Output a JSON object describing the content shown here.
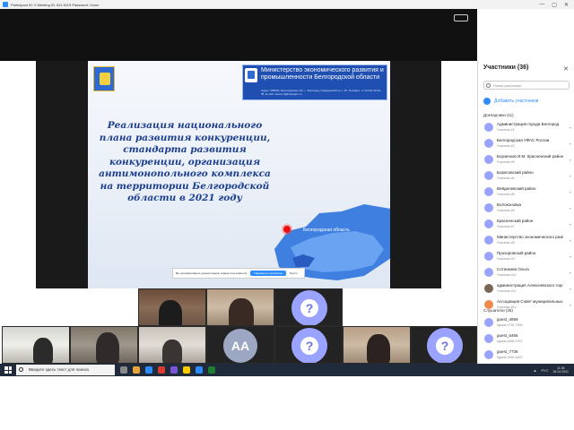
{
  "window": {
    "title": "Participant ID: 0 Meeting ID: 811 8119 Password: Zoom"
  },
  "slide": {
    "ministry_title": "Министерство экономического развития и промышленности Белгородской области",
    "ministry_small": "Адрес: 308000, Белгородская обл., г. Белгород, Гражданский пр-т, 18. Телефон: +7 (4722) 32-04-55. E-mail: minecon@belregion.ru",
    "main_title": "Реализация национального плана развития конкуренции, стандарта развития конкуренции, организация антимонопольного комплекса на территории Белгородской области в 2021 году",
    "region_label": "Белгородская область"
  },
  "banner": {
    "text": "Вы просматриваете демонстрацию экрана пользователя",
    "primary": "Параметры просмотра",
    "secondary": "Выйти"
  },
  "tiles": {
    "aa_initials": "AA"
  },
  "panel": {
    "title": "Участники (36)",
    "search_placeholder": "Поиск участника",
    "add_label": "Добавить участников",
    "section_joined": "Докладчики (11)",
    "section_waiting": "Слушатели (25)",
    "participants": [
      {
        "name": "Администрация города Белгород",
        "sub": "Участник #1"
      },
      {
        "name": "Белгородская УФАС России",
        "sub": "Участник #2"
      },
      {
        "name": "Борзенков И.М. Красненский район",
        "sub": "Участник #3"
      },
      {
        "name": "Борисовский район",
        "sub": "Участник #4"
      },
      {
        "name": "Вейделевский район",
        "sub": "Участник #5"
      },
      {
        "name": "Волоконовка",
        "sub": "Участник #6"
      },
      {
        "name": "Красненский район",
        "sub": "Участник #7"
      },
      {
        "name": "Министерство экономического развития",
        "sub": "Участник #8"
      },
      {
        "name": "Прохоровский район",
        "sub": "Участник #9"
      },
      {
        "name": "Сотникова Ольга",
        "sub": "Участник #10"
      },
      {
        "name": "администрация Алексеевского городского округа",
        "sub": "Участник #11"
      },
      {
        "name": "Ассоциация Совет муниципальных",
        "sub": "Участник #12"
      }
    ],
    "guests": [
      {
        "name": "guest_4959",
        "sub": "#guest-2791-7906"
      },
      {
        "name": "guest_6466",
        "sub": "#guest-4465-0791"
      },
      {
        "name": "guest_7736",
        "sub": "#guest-3492-6420"
      }
    ]
  },
  "taskbar": {
    "search_placeholder": "Введите здесь текст для поиска",
    "time": "11:28",
    "date": "26.04.2021",
    "lang": "РУС"
  }
}
